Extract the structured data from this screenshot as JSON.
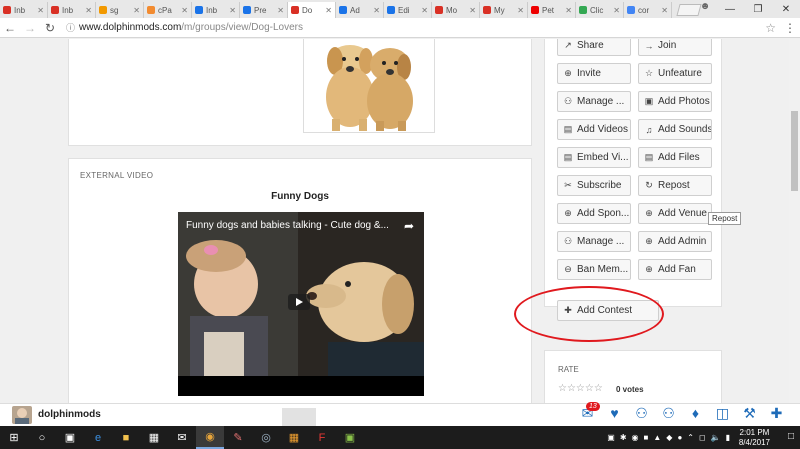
{
  "browser": {
    "tabs": [
      {
        "label": "Inb",
        "color": "#d93025"
      },
      {
        "label": "Inb",
        "color": "#d93025"
      },
      {
        "label": "sg",
        "color": "#f29900"
      },
      {
        "label": "cPa",
        "color": "#f28b30"
      },
      {
        "label": "Inb",
        "color": "#1a73e8"
      },
      {
        "label": "Pre",
        "color": "#1a73e8"
      },
      {
        "label": "Do",
        "color": "#d93025"
      },
      {
        "label": "Ad",
        "color": "#1a73e8"
      },
      {
        "label": "Edi",
        "color": "#1a73e8"
      },
      {
        "label": "Mo",
        "color": "#d93025"
      },
      {
        "label": "My",
        "color": "#d93025"
      },
      {
        "label": "Pet",
        "color": "#e00"
      },
      {
        "label": "Clic",
        "color": "#34a853"
      },
      {
        "label": "cor",
        "color": "#4285f4"
      }
    ],
    "active_tab_index": 6,
    "url_host": "www.dolphinmods.com",
    "url_path": "/m/groups/view/Dog-Lovers"
  },
  "video_card": {
    "label": "EXTERNAL VIDEO",
    "title": "Funny Dogs",
    "caption": "Funny dogs and babies talking - Cute dog &..."
  },
  "actions": [
    {
      "label": "Share",
      "icon": "share-icon"
    },
    {
      "label": "Join",
      "icon": "join-icon"
    },
    {
      "label": "Invite",
      "icon": "invite-icon"
    },
    {
      "label": "Unfeature",
      "icon": "star-icon"
    },
    {
      "label": "Manage ...",
      "icon": "users-icon"
    },
    {
      "label": "Add Photos",
      "icon": "photo-icon"
    },
    {
      "label": "Add Videos",
      "icon": "film-icon"
    },
    {
      "label": "Add Sounds",
      "icon": "music-icon"
    },
    {
      "label": "Embed Vi...",
      "icon": "film-icon"
    },
    {
      "label": "Add Files",
      "icon": "file-icon"
    },
    {
      "label": "Subscribe",
      "icon": "paperclip-icon"
    },
    {
      "label": "Repost",
      "icon": "repost-icon"
    },
    {
      "label": "Add Spon...",
      "icon": "plus-circle-icon"
    },
    {
      "label": "Add Venue",
      "icon": "plus-circle-icon"
    },
    {
      "label": "Manage ...",
      "icon": "users-icon"
    },
    {
      "label": "Add Admin",
      "icon": "plus-circle-icon"
    },
    {
      "label": "Ban Mem...",
      "icon": "minus-circle-icon"
    },
    {
      "label": "Add Fan",
      "icon": "plus-circle-icon"
    }
  ],
  "add_contest_label": "Add Contest",
  "tooltip": "Repost",
  "rate": {
    "title": "RATE",
    "votes": "0 votes"
  },
  "sitebar": {
    "username": "dolphinmods",
    "notification_count": "13"
  },
  "taskbar": {
    "time": "2:01 PM",
    "date": "8/4/2017"
  }
}
